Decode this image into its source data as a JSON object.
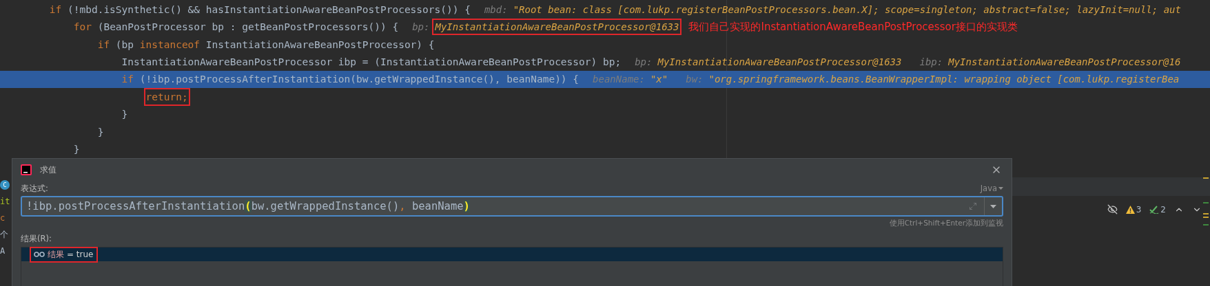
{
  "editor": {
    "lines": [
      {
        "highlighted": false,
        "code": [
          {
            "kind": "keyword",
            "text": "        if"
          },
          {
            "kind": "plain",
            "text": " (!mbd.isSynthetic() && hasInstantiationAwareBeanPostProcessors()) {"
          }
        ],
        "hints": [
          {
            "label": "mbd:",
            "value": "\"Root bean: class [com.lukp.registerBeanPostProcessors.bean.X]; scope=singleton; abstract=false; lazyInit=null; aut"
          }
        ]
      },
      {
        "highlighted": false,
        "code": [
          {
            "kind": "keyword",
            "text": "            for"
          },
          {
            "kind": "plain",
            "text": " (BeanPostProcessor bp : getBeanPostProcessors()) {"
          }
        ],
        "hints": [
          {
            "label": "bp:",
            "value": "MyInstantiationAwareBeanPostProcessor@1633",
            "boxed": true
          }
        ],
        "note": "我们自己实现的InstantiationAwareBeanPostProcessor接口的实现类"
      },
      {
        "highlighted": false,
        "code": [
          {
            "kind": "keyword",
            "text": "                if"
          },
          {
            "kind": "plain",
            "text": " (bp "
          },
          {
            "kind": "keyword",
            "text": "instanceof"
          },
          {
            "kind": "plain",
            "text": " InstantiationAwareBeanPostProcessor) {"
          }
        ]
      },
      {
        "highlighted": false,
        "code": [
          {
            "kind": "plain",
            "text": "                    InstantiationAwareBeanPostProcessor ibp = (InstantiationAwareBeanPostProcessor) bp;"
          }
        ],
        "hints": [
          {
            "label": "bp:",
            "value": "MyInstantiationAwareBeanPostProcessor@1633"
          },
          {
            "label": "ibp:",
            "value": "MyInstantiationAwareBeanPostProcessor@16"
          }
        ]
      },
      {
        "highlighted": true,
        "code": [
          {
            "kind": "keyword",
            "text": "                    if"
          },
          {
            "kind": "plain",
            "text": " (!ibp.postProcessAfterInstantiation(bw.getWrappedInstance(), beanName)) {"
          }
        ],
        "hints": [
          {
            "label": "beanName:",
            "value": "\"x\""
          },
          {
            "label": "bw:",
            "value": "\"org.springframework.beans.BeanWrapperImpl: wrapping object [com.lukp.registerBea"
          }
        ]
      },
      {
        "highlighted": false,
        "code": [
          {
            "kind": "keyword",
            "text": "                        return;",
            "boxed": true
          }
        ]
      },
      {
        "highlighted": false,
        "code": [
          {
            "kind": "plain",
            "text": "                    }"
          }
        ]
      },
      {
        "highlighted": false,
        "code": [
          {
            "kind": "plain",
            "text": "                }"
          }
        ]
      },
      {
        "highlighted": false,
        "code": [
          {
            "kind": "plain",
            "text": "            }"
          }
        ]
      }
    ]
  },
  "side_fragments": [
    {
      "kind": "class-icon",
      "text": "C"
    },
    {
      "kind": "link",
      "text": "it"
    },
    {
      "kind": "keyword",
      "text": "c"
    },
    {
      "kind": "plain",
      "text": "个"
    },
    {
      "kind": "plain",
      "text": "A"
    }
  ],
  "dialog": {
    "title": "求值",
    "expression_label": "表达式:",
    "language": "Java",
    "expression": [
      {
        "kind": "plain",
        "text": "!ibp.postProcessAfterInstantiation"
      },
      {
        "kind": "match",
        "text": "("
      },
      {
        "kind": "plain",
        "text": "bw.getWrappedInstance()"
      },
      {
        "kind": "keyword",
        "text": ","
      },
      {
        "kind": "plain",
        "text": " beanName"
      },
      {
        "kind": "match",
        "text": ")"
      }
    ],
    "hint": "使用Ctrl+Shift+Enter添加到监视",
    "result_label": "结果(R):",
    "results": [
      {
        "name": "结果",
        "value": "= true",
        "selected": true,
        "boxed": true
      }
    ]
  },
  "inspections": {
    "warnings": "3",
    "passed": "2"
  }
}
